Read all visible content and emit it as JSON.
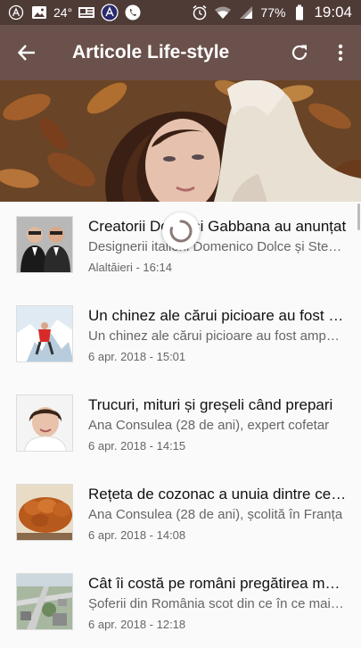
{
  "status_bar": {
    "temperature": "24°",
    "battery": "77%",
    "time": "19:04",
    "icons": [
      "signal-a-icon",
      "image-icon",
      "weather-icon",
      "news-icon",
      "app-icon",
      "phone-icon",
      "alarm-icon",
      "wifi-icon",
      "cell-signal-icon",
      "battery-icon"
    ]
  },
  "app_bar": {
    "title": "Articole Life-style",
    "icons": [
      "back-arrow-icon",
      "refresh-icon",
      "more-vert-icon"
    ]
  },
  "articles": [
    {
      "title": "Creatorii Dolce și Gabbana au anunțat",
      "desc": "Designerii italieni Domenico Dolce și Stefano",
      "date": "Alaltăieri - 16:14"
    },
    {
      "title": "Un chinez ale cărui picioare au fost amputate",
      "desc": "Un chinez ale cărui picioare au fost amputate",
      "date": "6 apr. 2018 - 15:01"
    },
    {
      "title": "Trucuri, mituri și greșeli când prepari",
      "desc": "Ana Consulea (28 de ani), expert cofetar",
      "date": "6 apr. 2018 - 14:15"
    },
    {
      "title": "Rețeta de cozonac a unuia dintre cei mai",
      "desc": "Ana Consulea (28 de ani), școlită în Franța",
      "date": "6 apr. 2018 - 14:08"
    },
    {
      "title": "Cât îi costă pe români pregătirea mesei",
      "desc": "Șoferii din România scot din ce în ce mai mulți",
      "date": "6 apr. 2018 - 12:18"
    }
  ],
  "colors": {
    "status_bar": "#4e3b36",
    "app_bar": "#6b514b",
    "background": "#fafafa"
  }
}
